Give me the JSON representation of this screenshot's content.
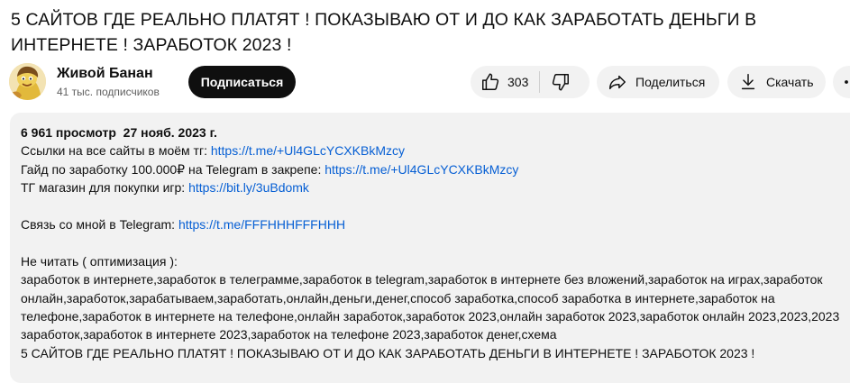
{
  "video": {
    "title": "5 САЙТОВ ГДЕ РЕАЛЬНО ПЛАТЯТ ! ПОКАЗЫВАЮ ОТ И ДО КАК ЗАРАБОТАТЬ ДЕНЬГИ В ИНТЕРНЕТЕ ! ЗАРАБОТОК 2023 !"
  },
  "channel": {
    "name": "Живой Банан",
    "subscribers": "41 тыс. подписчиков",
    "subscribe_label": "Подписаться"
  },
  "actions": {
    "like_count": "303",
    "share_label": "Поделиться",
    "download_label": "Скачать",
    "like_icon": "thumb-up-icon",
    "dislike_icon": "thumb-down-icon",
    "share_icon": "share-icon",
    "download_icon": "download-icon",
    "more_icon": "more-icon"
  },
  "description": {
    "views": "6 961 просмотр",
    "date": "27 нояб. 2023 г.",
    "line1_text": "Ссылки на все сайты в моём тг: ",
    "line1_link": "https://t.me/+Ul4GLcYCXKBkMzcy",
    "line2_text": "Гайд по заработку 100.000₽ на Telegram в закрепе: ",
    "line2_link": "https://t.me/+Ul4GLcYCXKBkMzcy",
    "line3_text": "ТГ магазин для покупки игр: ",
    "line3_link": "https://bit.ly/3uBdomk",
    "line4_text": "Связь со мной в Telegram: ",
    "line4_link": "https://t.me/FFFHHHFFFHHH",
    "seo_header": "Не читать ( оптимизация ):",
    "seo_lines": [
      "заработок в интернете,заработок в телеграмме,заработок в telegram,заработок в интернете без вложений,заработок на играх,заработок",
      "онлайн,заработок,зарабатываем,заработать,онлайн,деньги,денег,способ заработка,способ заработка в интернете,заработок на",
      "телефоне,заработок в интернете на телефоне,онлайн заработок,заработок 2023,онлайн заработок 2023,заработок онлайн 2023,2023,2023",
      "заработок,заработок в интернете 2023,заработок на телефоне 2023,заработок денег,схема"
    ],
    "footer_title": "5 САЙТОВ ГДЕ РЕАЛЬНО ПЛАТЯТ ! ПОКАЗЫВАЮ ОТ И ДО КАК ЗАРАБОТАТЬ ДЕНЬГИ В ИНТЕРНЕТЕ ! ЗАРАБОТОК 2023 !"
  }
}
